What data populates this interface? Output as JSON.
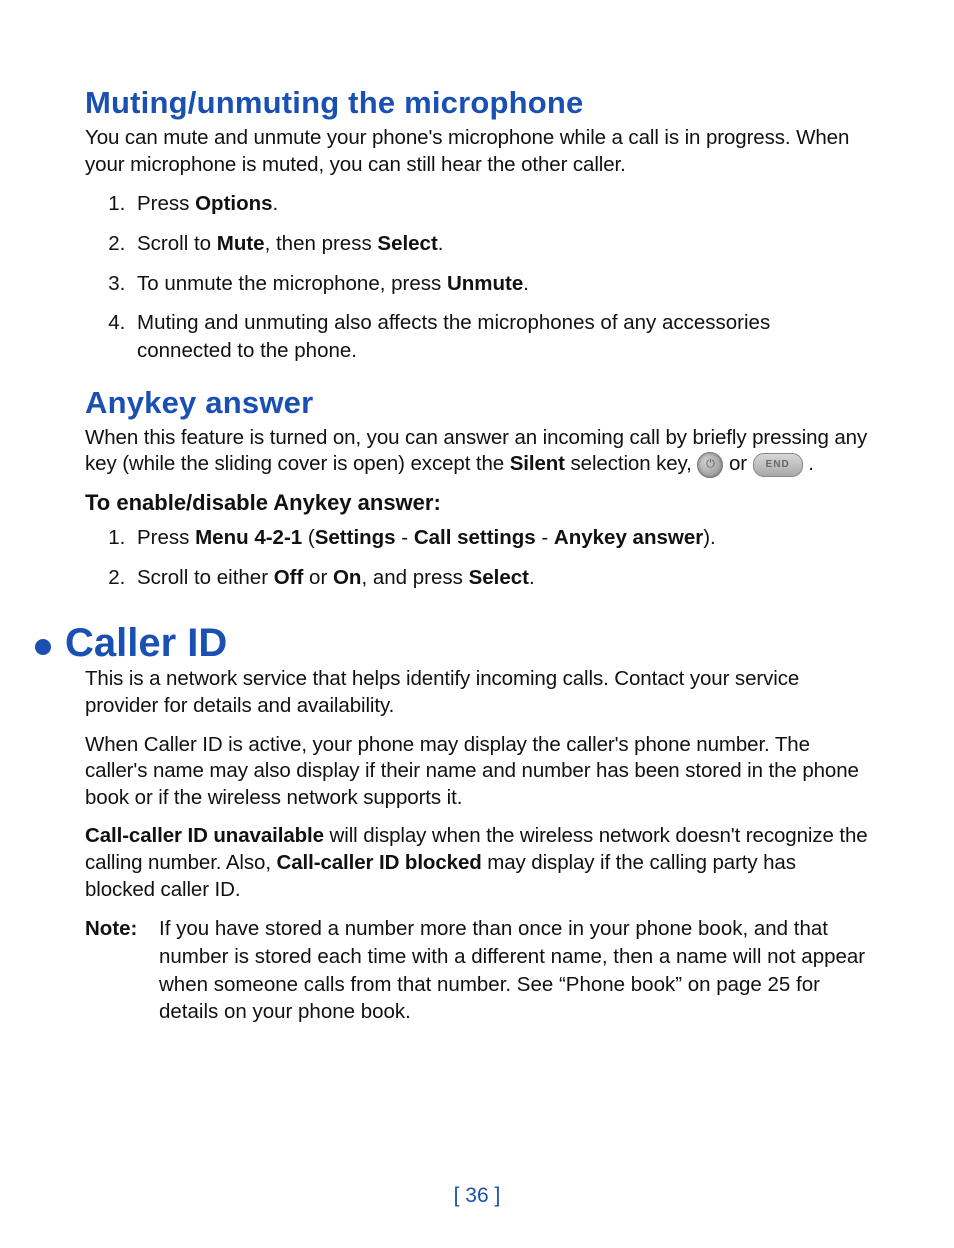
{
  "section1": {
    "heading": "Muting/unmuting the microphone",
    "para": "You can mute and unmute your phone's microphone while a call is in progress. When your microphone is muted, you can still hear the other caller.",
    "steps": {
      "s1_a": "Press ",
      "s1_b": "Options",
      "s1_c": ".",
      "s2_a": "Scroll to ",
      "s2_b": "Mute",
      "s2_c": ", then press ",
      "s2_d": "Select",
      "s2_e": ".",
      "s3_a": "To unmute the microphone, press ",
      "s3_b": "Unmute",
      "s3_c": ".",
      "s4": "Muting and unmuting also affects the microphones of any accessories connected to the phone."
    }
  },
  "section2": {
    "heading": "Anykey answer",
    "para_a": "When this feature is turned on, you can answer an incoming call by briefly pressing any key (while the sliding cover is open) except the ",
    "para_b": "Silent",
    "para_c": " selection key, ",
    "para_d": " or ",
    "para_e": " .",
    "sub_heading": "To enable/disable Anykey answer:",
    "steps": {
      "s1_a": "Press ",
      "s1_b": "Menu 4-2-1",
      "s1_c": " (",
      "s1_d": "Settings",
      "s1_e": " - ",
      "s1_f": "Call settings",
      "s1_g": " - ",
      "s1_h": "Anykey answer",
      "s1_i": ").",
      "s2_a": "Scroll to either ",
      "s2_b": "Off",
      "s2_c": " or ",
      "s2_d": "On",
      "s2_e": ", and press ",
      "s2_f": "Select",
      "s2_g": "."
    }
  },
  "section3": {
    "heading": "Caller ID",
    "p1": "This is a network service that helps identify incoming calls. Contact your service provider for details and availability.",
    "p2": "When Caller ID is active, your phone may display the caller's phone number. The caller's name may also display if their name and number has been stored in the phone book or if the wireless network supports it.",
    "p3_a": "Call-caller ID unavailable",
    "p3_b": " will display when the wireless network doesn't recognize the calling number. Also, ",
    "p3_c": "Call-caller ID blocked",
    "p3_d": " may display if the calling party has blocked caller ID.",
    "note_label": "Note:",
    "note_text": "If you have stored a number more than once in your phone book, and that number is stored each time with a different name, then a name will not appear when someone calls from that number. See “Phone book” on page 25 for details on your phone book."
  },
  "icons": {
    "power": "⏻",
    "end": "END"
  },
  "page_number": "[ 36 ]"
}
